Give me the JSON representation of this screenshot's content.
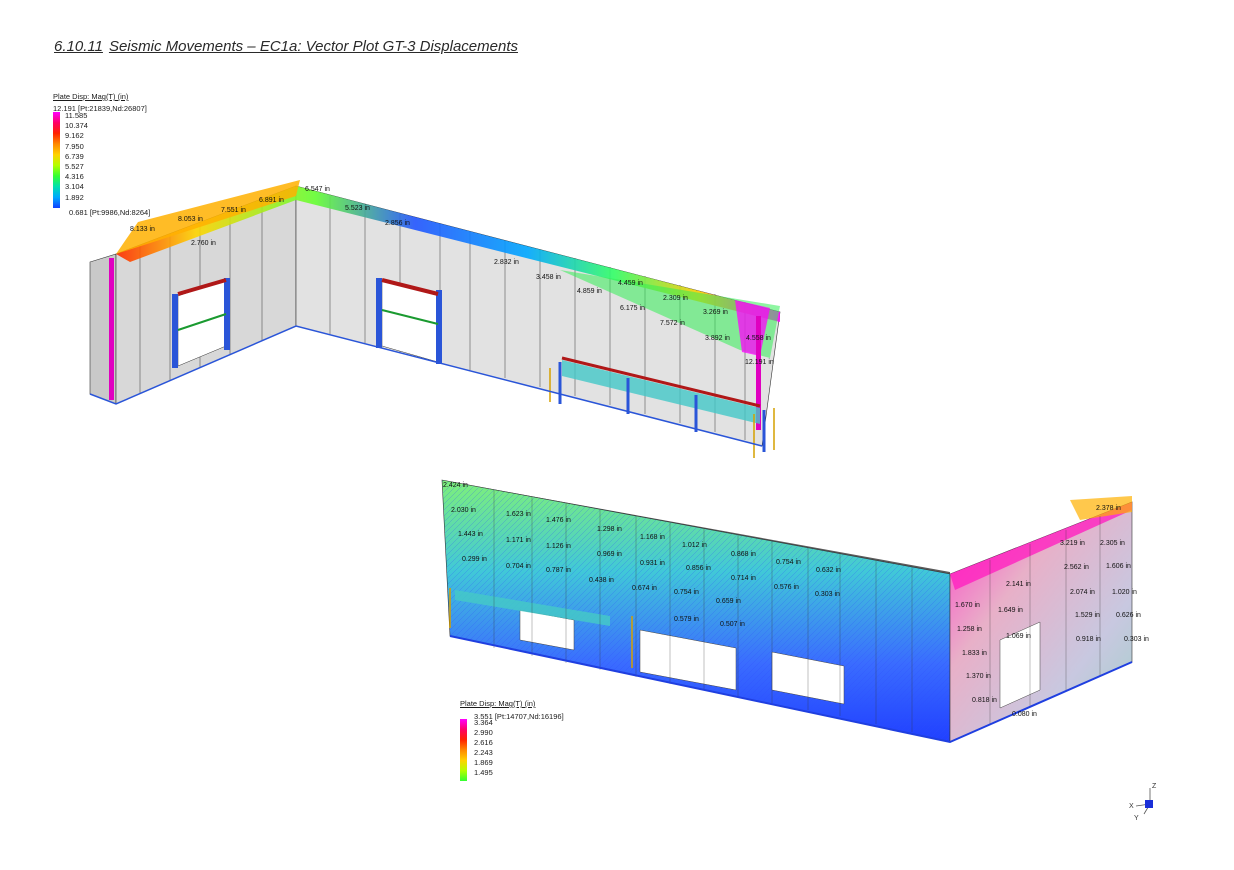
{
  "title": {
    "section": "6.10.11",
    "text": "Seismic Movements – EC1a: Vector Plot GT-3 Displacements"
  },
  "legend_top": {
    "title": "Plate Disp: Mag(T)  (in)",
    "max_label": "12.191 [Pt:21839,Nd:26807]",
    "ticks": [
      "11.585",
      "10.374",
      "9.162",
      "7.950",
      "6.739",
      "5.527",
      "4.316",
      "3.104",
      "1.892"
    ],
    "min_label": "0.681 [Pt:9986,Nd:8264]",
    "colors": [
      "#ff00ff",
      "#ff0066",
      "#ff2200",
      "#ff8800",
      "#ffd200",
      "#b4ff00",
      "#33ff33",
      "#00e0b0",
      "#00a8ff",
      "#1040ff"
    ]
  },
  "legend_bottom": {
    "title": "Plate Disp: Mag(T)  (in)",
    "max_label": "3.551 [Pt:14707,Nd:16196]",
    "ticks": [
      "3.364",
      "2.990",
      "2.616",
      "2.243",
      "1.869",
      "1.495"
    ],
    "colors": [
      "#ff00ff",
      "#ff0066",
      "#ff2200",
      "#ff8800",
      "#ffd200",
      "#b4ff00",
      "#33ff33"
    ]
  },
  "top_model_labels": [
    "6.547 in",
    "6.891 in",
    "7.551 in",
    "8.053 in",
    "8.133 in",
    "2.760 in",
    "5.523 in",
    "2.856 in",
    "2.832 in",
    "3.458 in",
    "4.859 in",
    "4.459 in",
    "2.309 in",
    "6.175 in",
    "7.572 in",
    "3.269 in",
    "3.892 in",
    "4.558 in",
    "12.191 in"
  ],
  "bottom_model_labels": [
    "2.424 in",
    "2.030 in",
    "1.623 in",
    "1.476 in",
    "1.298 in",
    "1.168 in",
    "1.443 in",
    "1.171 in",
    "1.126 in",
    "0.969 in",
    "1.012 in",
    "0.868 in",
    "0.299 in",
    "0.704 in",
    "0.787 in",
    "0.931 in",
    "0.856 in",
    "0.754 in",
    "0.632 in",
    "0.438 in",
    "0.674 in",
    "0.754 in",
    "0.714 in",
    "0.576 in",
    "0.303 in",
    "0.659 in",
    "0.579 in",
    "0.507 in",
    "2.378 in",
    "2.305 in",
    "3.219 in",
    "2.562 in",
    "1.606 in",
    "2.141 in",
    "2.074 in",
    "1.020 in",
    "1.670 in",
    "1.649 in",
    "1.529 in",
    "0.626 in",
    "1.258 in",
    "1.069 in",
    "0.918 in",
    "0.303 in",
    "1.833 in",
    "1.370 in",
    "0.818 in",
    "0.080 in"
  ],
  "triad": {
    "z": "Z",
    "x": "X",
    "y": "Y"
  }
}
